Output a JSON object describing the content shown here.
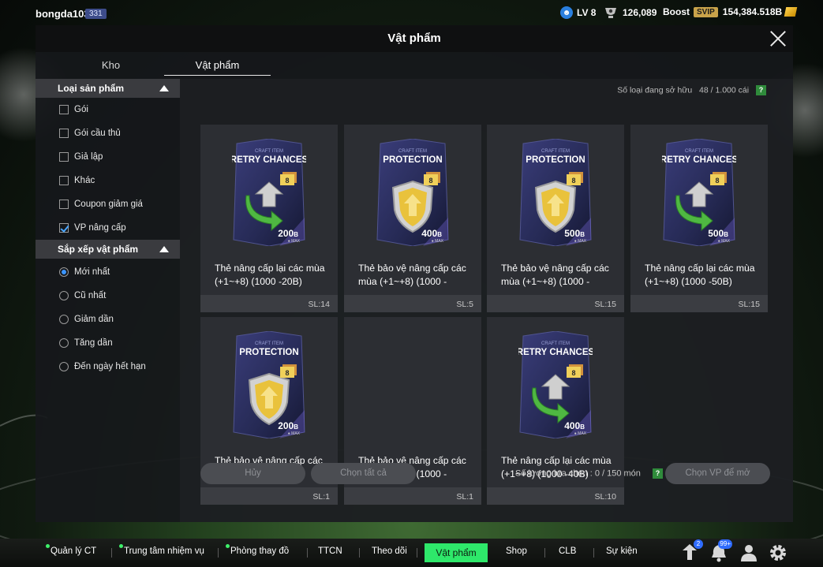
{
  "user": {
    "name": "bongda103",
    "level_badge": "331"
  },
  "resources": {
    "level": "LV 8",
    "coins": "126,089",
    "boost_label": "Boost",
    "svip": "SVIP",
    "bp": "154,384.518B"
  },
  "panel": {
    "title": "Vật phẩm"
  },
  "tabs": [
    {
      "label": "Kho",
      "active": false
    },
    {
      "label": "Vật phẩm",
      "active": true
    }
  ],
  "sidebar": {
    "type_header": "Loại sản phẩm",
    "types": [
      {
        "label": "Gói",
        "checked": false
      },
      {
        "label": "Gói cầu thủ",
        "checked": false
      },
      {
        "label": "Giả lập",
        "checked": false
      },
      {
        "label": "Khác",
        "checked": false
      },
      {
        "label": "Coupon giảm giá",
        "checked": false
      },
      {
        "label": "VP nâng cấp",
        "checked": true
      }
    ],
    "sort_header": "Sắp xếp vật phẩm",
    "sorts": [
      {
        "label": "Mới nhất",
        "checked": true
      },
      {
        "label": "Cũ nhất",
        "checked": false
      },
      {
        "label": "Giảm dần",
        "checked": false
      },
      {
        "label": "Tăng dần",
        "checked": false
      },
      {
        "label": "Đến ngày hết hạn",
        "checked": false
      }
    ]
  },
  "owned": {
    "label": "Số loại đang sở hữu",
    "value": "48 / 1.000 cái",
    "help": "?"
  },
  "cards": [
    {
      "kind": "retry",
      "sub": "CRAFT ITEM",
      "head": "RETRY CHANCES",
      "level": "8",
      "amount": "200",
      "unit": "B",
      "max": "MAX",
      "name": "Thẻ nâng cấp lại các mùa (+1~+8) (1000 -20B)",
      "qty": "SL:14"
    },
    {
      "kind": "protect",
      "sub": "CRAFT ITEM",
      "head": "PROTECTION",
      "level": "8",
      "amount": "400",
      "unit": "B",
      "max": "MAX",
      "name": "Thẻ bảo vệ nâng cấp các mùa (+1~+8) (1000 -",
      "qty": "SL:5"
    },
    {
      "kind": "protect",
      "sub": "CRAFT ITEM",
      "head": "PROTECTION",
      "level": "8",
      "amount": "500",
      "unit": "B",
      "max": "MAX",
      "name": "Thẻ bảo vệ nâng cấp các mùa (+1~+8) (1000 -",
      "qty": "SL:15"
    },
    {
      "kind": "retry",
      "sub": "CRAFT ITEM",
      "head": "RETRY CHANCES",
      "level": "8",
      "amount": "500",
      "unit": "B",
      "max": "MAX",
      "name": "Thẻ nâng cấp lại các mùa (+1~+8) (1000 -50B)",
      "qty": "SL:15"
    },
    {
      "kind": "protect",
      "sub": "CRAFT ITEM",
      "head": "PROTECTION",
      "level": "8",
      "amount": "200",
      "unit": "B",
      "max": "MAX",
      "name": "Thẻ bảo vệ nâng cấp các mùa (+1~+8) (1000 -",
      "qty": "SL:1"
    },
    {
      "kind": "empty",
      "sub": "",
      "head": "",
      "level": "",
      "amount": "",
      "unit": "",
      "max": "",
      "name": "Thẻ bảo vệ nâng cấp các mùa (+1~+8) (1000 -",
      "qty": "SL:1"
    },
    {
      "kind": "retry",
      "sub": "CRAFT ITEM",
      "head": "RETRY CHANCES",
      "level": "8",
      "amount": "400",
      "unit": "B",
      "max": "MAX",
      "name": "Thẻ nâng cấp lại các mùa (+1~+8) (1000 -40B)",
      "qty": "SL:10"
    }
  ],
  "actions": {
    "cancel": "Hủy",
    "select_all": "Chọn tất cả",
    "selection_label": "Số lượng lựa chọn : 0 / 150 món",
    "help": "?",
    "open": "Chọn VP để mở"
  },
  "bottom_nav": [
    {
      "label": "Quản lý CT",
      "dot": true
    },
    {
      "label": "Trung tâm nhiệm vụ",
      "dot": true
    },
    {
      "label": "Phòng thay đồ",
      "dot": true
    },
    {
      "label": "TTCN",
      "dot": false
    },
    {
      "label": "Theo dõi",
      "dot": false
    },
    {
      "label": "Vật phẩm",
      "dot": false,
      "active": true
    },
    {
      "label": "Shop",
      "dot": false
    },
    {
      "label": "CLB",
      "dot": false
    },
    {
      "label": "Sự kiện",
      "dot": false
    }
  ],
  "bottom_icons": [
    {
      "icon": "upload-icon",
      "badge": "2"
    },
    {
      "icon": "bell-icon",
      "badge": "99+"
    },
    {
      "icon": "person-icon",
      "badge": ""
    },
    {
      "icon": "gear-icon",
      "badge": ""
    }
  ],
  "colors": {
    "accent": "#2ee86a",
    "help": "#2f8b3b",
    "card_bg": "#2c2e33"
  }
}
